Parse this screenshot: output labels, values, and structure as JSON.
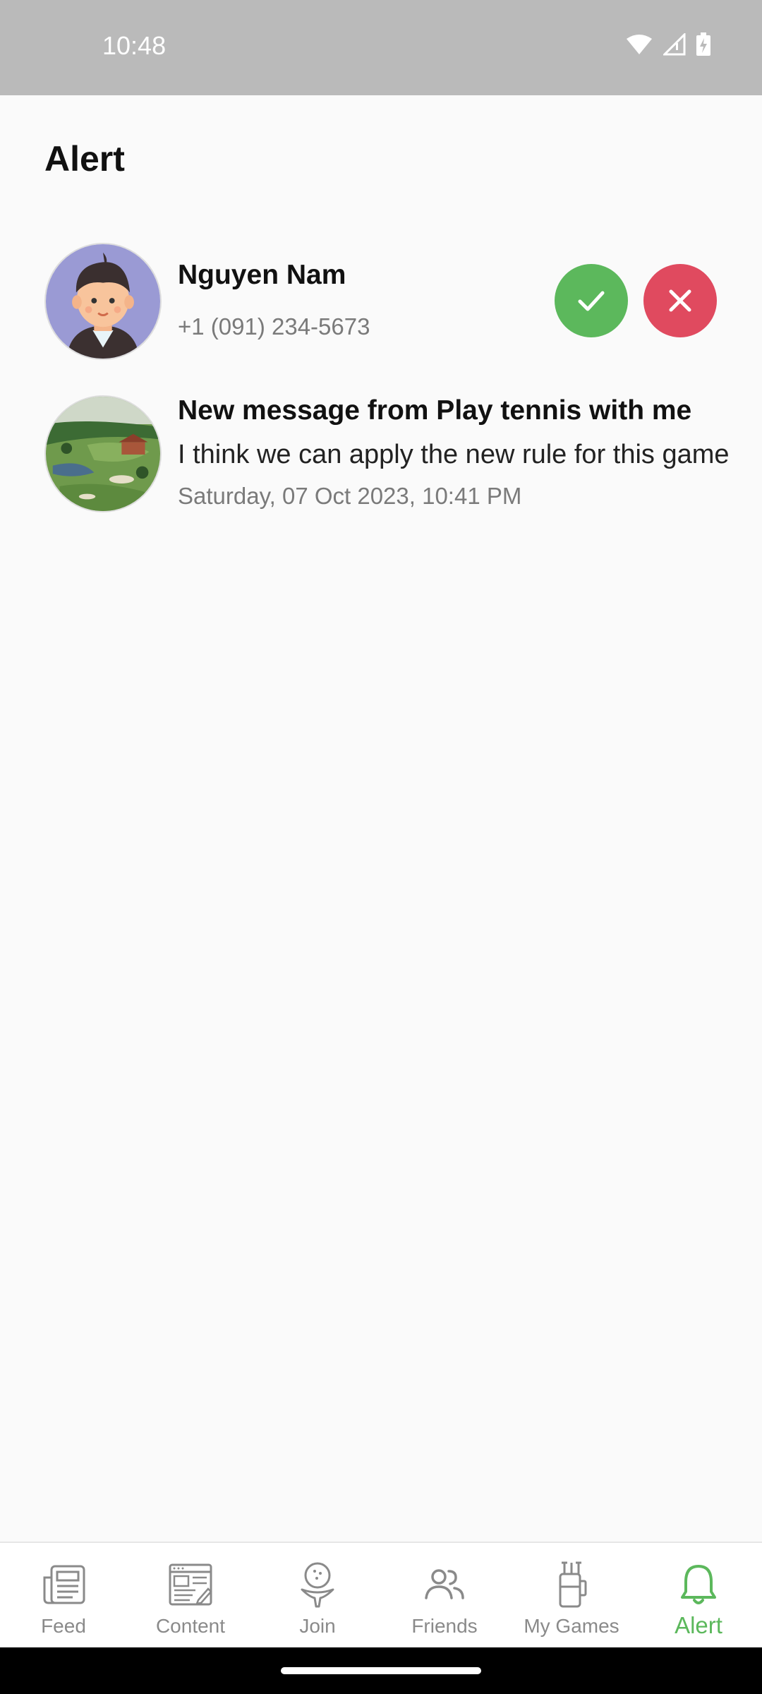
{
  "status_bar": {
    "time": "10:48"
  },
  "page": {
    "title": "Alert"
  },
  "alerts": [
    {
      "name": "Nguyen Nam",
      "phone": "+1 (091) 234-5673",
      "accept_icon": "check-icon",
      "decline_icon": "close-icon",
      "accent_accept": "#5cb85c",
      "accent_decline": "#e04a5f"
    },
    {
      "title": "New message from Play tennis with me",
      "message": "I think we can apply the new rule for this game",
      "timestamp": "Saturday, 07 Oct 2023, 10:41 PM"
    }
  ],
  "tabs": [
    {
      "label": "Feed",
      "icon": "newspaper-icon"
    },
    {
      "label": "Content",
      "icon": "article-icon"
    },
    {
      "label": "Join",
      "icon": "golf-tee-icon"
    },
    {
      "label": "Friends",
      "icon": "people-icon"
    },
    {
      "label": "My Games",
      "icon": "golf-bag-icon"
    },
    {
      "label": "Alert",
      "icon": "bell-icon",
      "active": true
    }
  ],
  "colors": {
    "active_tab": "#5cb85c",
    "inactive_tab": "#8a8a8a"
  }
}
